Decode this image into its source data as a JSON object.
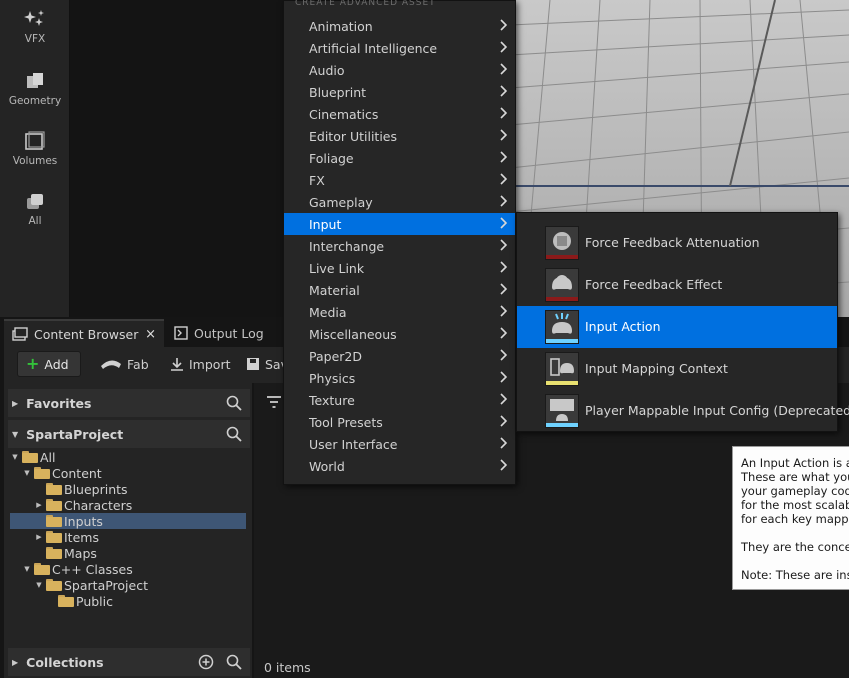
{
  "modes": [
    {
      "label": "VFX",
      "icon": "sparkle-icon"
    },
    {
      "label": "Geometry",
      "icon": "cube-icon"
    },
    {
      "label": "Volumes",
      "icon": "volume-box-icon"
    },
    {
      "label": "All",
      "icon": "stack-icon"
    }
  ],
  "tabs": {
    "content_browser": "Content Browser",
    "output_log": "Output Log",
    "close_glyph": "×"
  },
  "toolbar": {
    "add": "Add",
    "fab": "Fab",
    "import": "Import",
    "save": "Sav"
  },
  "sources": {
    "favorites": "Favorites",
    "project": "SpartaProject",
    "collections": "Collections"
  },
  "tree": [
    {
      "label": "All",
      "depth": 0,
      "arrow": "▼",
      "selected": false
    },
    {
      "label": "Content",
      "depth": 1,
      "arrow": "▼",
      "selected": false
    },
    {
      "label": "Blueprints",
      "depth": 2,
      "arrow": "",
      "selected": false
    },
    {
      "label": "Characters",
      "depth": 2,
      "arrow": "▶",
      "selected": false
    },
    {
      "label": "Inputs",
      "depth": 2,
      "arrow": "",
      "selected": true
    },
    {
      "label": "Items",
      "depth": 2,
      "arrow": "▶",
      "selected": false
    },
    {
      "label": "Maps",
      "depth": 2,
      "arrow": "",
      "selected": false
    },
    {
      "label": "C++ Classes",
      "depth": 1,
      "arrow": "▼",
      "selected": false
    },
    {
      "label": "SpartaProject",
      "depth": 2,
      "arrow": "▼",
      "selected": false
    },
    {
      "label": "Public",
      "depth": 3,
      "arrow": "",
      "selected": false
    }
  ],
  "content": {
    "items_count": "0 items"
  },
  "menu": {
    "header": "CREATE ADVANCED ASSET",
    "items": [
      "Animation",
      "Artificial Intelligence",
      "Audio",
      "Blueprint",
      "Cinematics",
      "Editor Utilities",
      "Foliage",
      "FX",
      "Gameplay",
      "Input",
      "Interchange",
      "Live Link",
      "Material",
      "Media",
      "Miscellaneous",
      "Paper2D",
      "Physics",
      "Texture",
      "Tool Presets",
      "User Interface",
      "World"
    ],
    "highlighted": "Input"
  },
  "submenu": {
    "items": [
      {
        "label": "Force Feedback Attenuation",
        "icon": "force-feedback-attenuation-icon",
        "bar_color": "#8b1a1a"
      },
      {
        "label": "Force Feedback Effect",
        "icon": "gamepad-icon",
        "bar_color": "#8b1a1a"
      },
      {
        "label": "Input Action",
        "icon": "input-action-icon",
        "bar_color": "#6fd2ff"
      },
      {
        "label": "Input Mapping Context",
        "icon": "input-mapping-icon",
        "bar_color": "#e8e070"
      },
      {
        "label": "Player Mappable Input Config (Deprecated)",
        "icon": "keyboard-gamepad-icon",
        "bar_color": "#6fd2ff"
      }
    ],
    "highlighted": "Input Action"
  },
  "tooltip": {
    "lines": [
      "An Input Action is a",
      "These are what your",
      "your gameplay code",
      "for the most scalabl",
      "for each key mappin",
      "",
      "They are the concep",
      "",
      "Note: These are insta"
    ]
  },
  "colors": {
    "highlight": "#0070e0",
    "tree_selected": "#3e5675",
    "add_plus": "#33c23a"
  }
}
